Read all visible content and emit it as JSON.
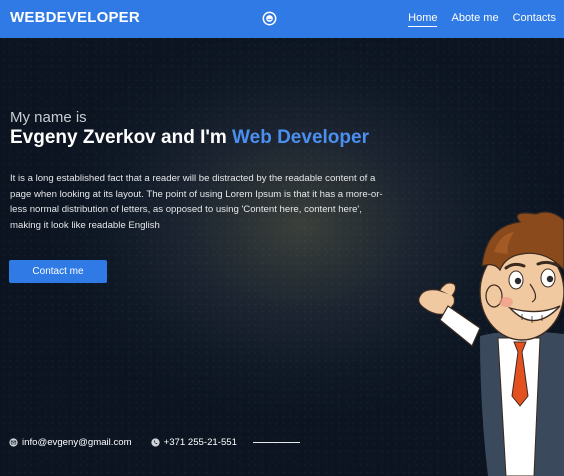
{
  "header": {
    "brand": "WEBDEVELOPER",
    "nav": [
      {
        "label": "Home",
        "active": true
      },
      {
        "label": "Abote me",
        "active": false
      },
      {
        "label": "Contacts",
        "active": false
      }
    ],
    "logo_icon": "smiley-icon"
  },
  "hero": {
    "intro": "My name is",
    "headline_prefix": "Evgeny Zverkov and I'm ",
    "headline_accent": "Web Developer",
    "description": "It is a long established fact that a reader will be distracted by the readable content of a page when looking at its layout. The point of using Lorem Ipsum is that it has a more-or-less normal distribution of letters, as opposed to using 'Content here, content here', making it look like readable English",
    "button_label": "Contact me"
  },
  "footer": {
    "email": "info@evgeny@gmail.com",
    "email_icon": "email-icon",
    "phone": "+371 255-21-551",
    "phone_icon": "phone-icon"
  },
  "colors": {
    "accent": "#2f7ae5",
    "accent_text": "#4b8ff0",
    "background": "#0f1825"
  }
}
